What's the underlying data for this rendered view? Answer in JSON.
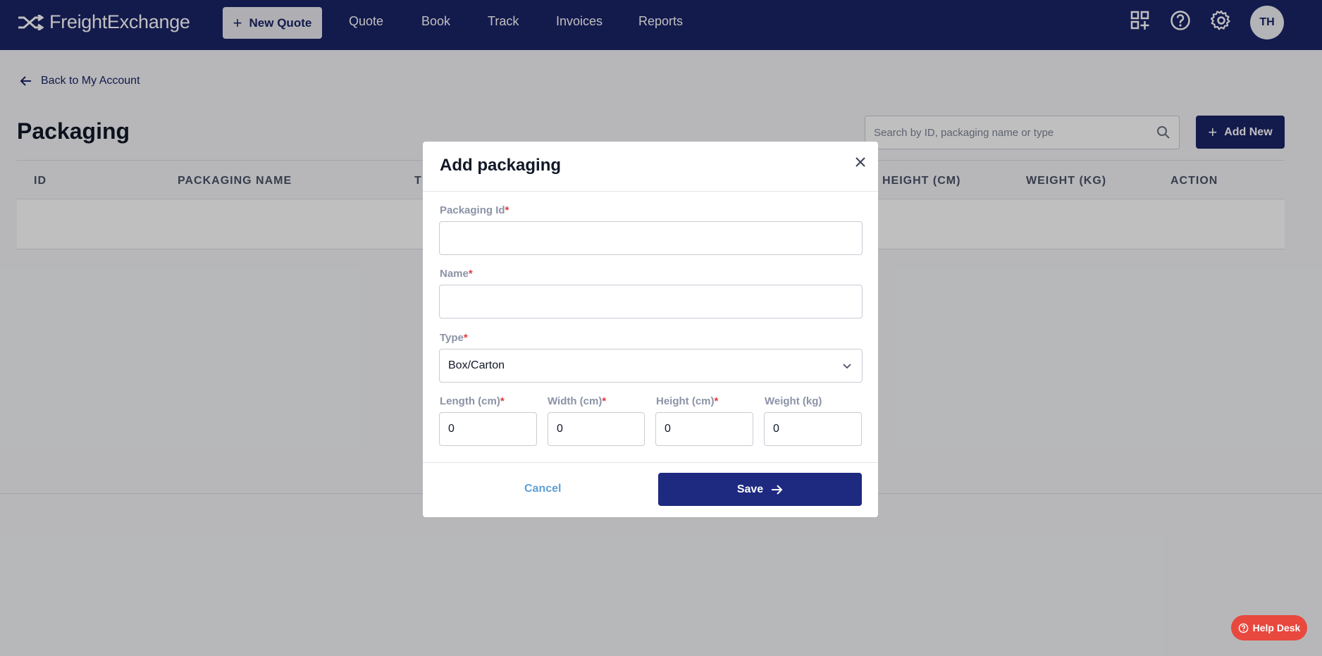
{
  "nav": {
    "brand": "FreightExchange",
    "new_quote": "New Quote",
    "links": [
      "Quote",
      "Book",
      "Track",
      "Invoices",
      "Reports"
    ],
    "avatar": "TH"
  },
  "page": {
    "back": "Back to My Account",
    "title": "Packaging",
    "search_placeholder": "Search by ID, packaging name or type",
    "add_new": "Add New",
    "columns": [
      "ID",
      "PACKAGING NAME",
      "T",
      "HEIGHT (CM)",
      "WEIGHT (KG)",
      "ACTION"
    ]
  },
  "modal": {
    "title": "Add packaging",
    "packaging_id_label": "Packaging Id",
    "packaging_id_value": "",
    "name_label": "Name",
    "name_value": "",
    "type_label": "Type",
    "type_value": "Box/Carton",
    "length_label": "Length (cm)",
    "length_value": "0",
    "width_label": "Width (cm)",
    "width_value": "0",
    "height_label": "Height (cm)",
    "height_value": "0",
    "weight_label": "Weight (kg)",
    "weight_value": "0",
    "required_mark": "*",
    "cancel": "Cancel",
    "save": "Save"
  },
  "help_desk": "Help Desk",
  "colors": {
    "nav": "#1a2366",
    "primary": "#1e2a80",
    "required": "#e23b3b",
    "help": "#e8483d"
  }
}
